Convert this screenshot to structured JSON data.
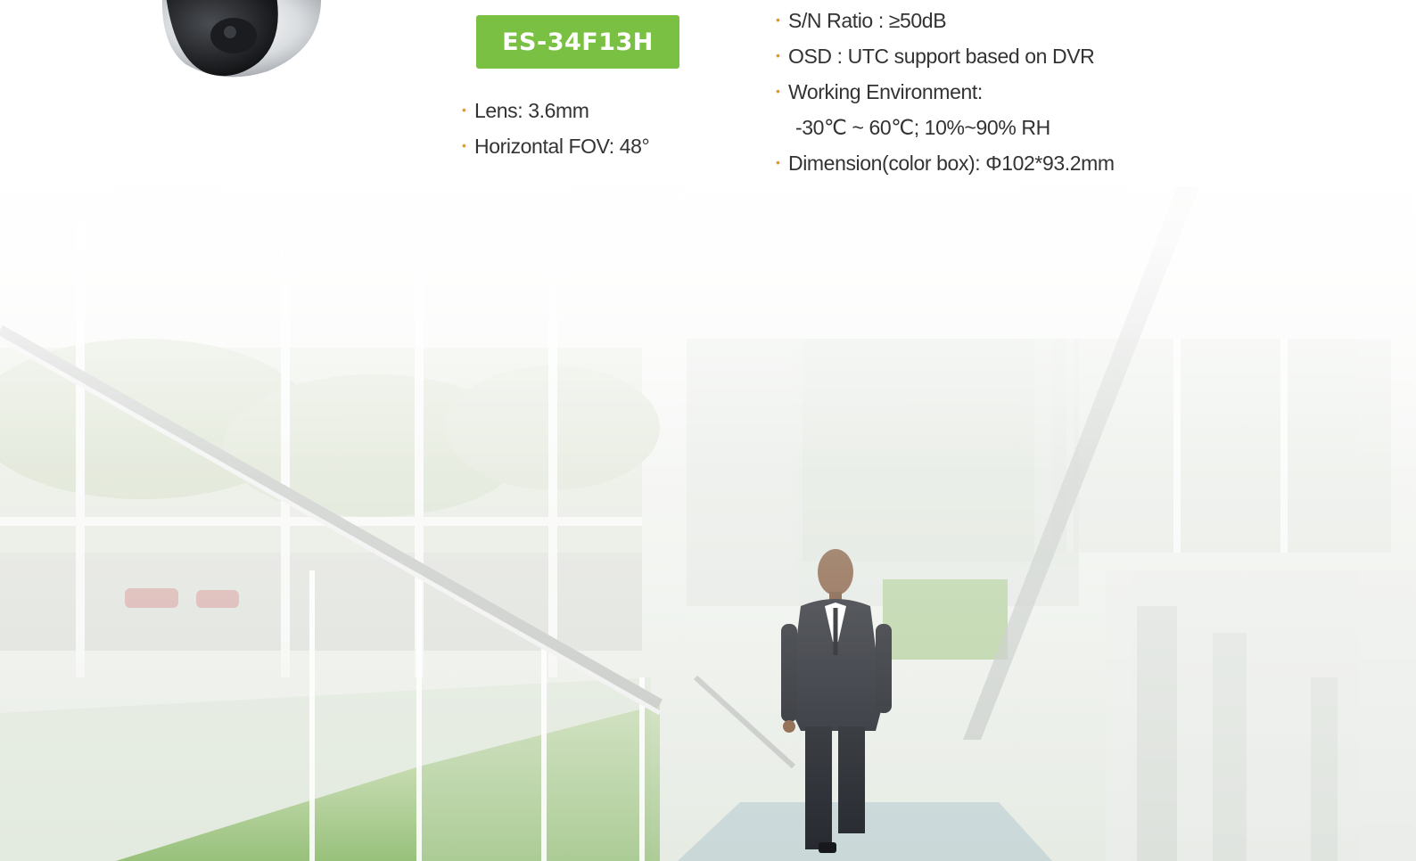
{
  "product": {
    "model": "ES-34F13H"
  },
  "specs_left": [
    {
      "text": "Lens: 3.6mm"
    },
    {
      "text": "Horizontal FOV: 48°"
    }
  ],
  "specs_right": [
    {
      "text": "S/N Ratio : ≥50dB",
      "bullet": true
    },
    {
      "text": "OSD : UTC support based on DVR",
      "bullet": true
    },
    {
      "text": "Working Environment:",
      "bullet": true
    },
    {
      "text": "-30℃ ~ 60℃; 10%~90% RH",
      "bullet": false
    },
    {
      "text": "Dimension(color box): Φ102*93.2mm",
      "bullet": true
    }
  ],
  "colors": {
    "badge": "#7ac043",
    "bullet": "#e39a2a",
    "text": "#333333"
  },
  "image": {
    "content": "dome-camera-photo, office-staircase-with-businessman-photo"
  }
}
